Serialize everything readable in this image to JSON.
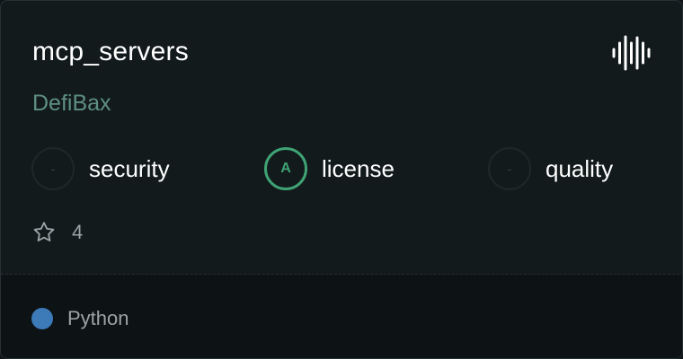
{
  "repo": {
    "name": "mcp_servers",
    "owner": "DefiBax"
  },
  "scores": [
    {
      "grade": "-",
      "label": "security",
      "state": "empty"
    },
    {
      "grade": "A",
      "label": "license",
      "state": "active"
    },
    {
      "grade": "-",
      "label": "quality",
      "state": "empty"
    }
  ],
  "stars": {
    "count": "4",
    "icon": "star-outline-icon"
  },
  "language": {
    "name": "Python",
    "color": "#3d7ab8"
  },
  "icons": {
    "audio": "audio-waveform-icon"
  },
  "colors": {
    "grade_active": "#3fa374",
    "owner": "#5e8f81"
  }
}
